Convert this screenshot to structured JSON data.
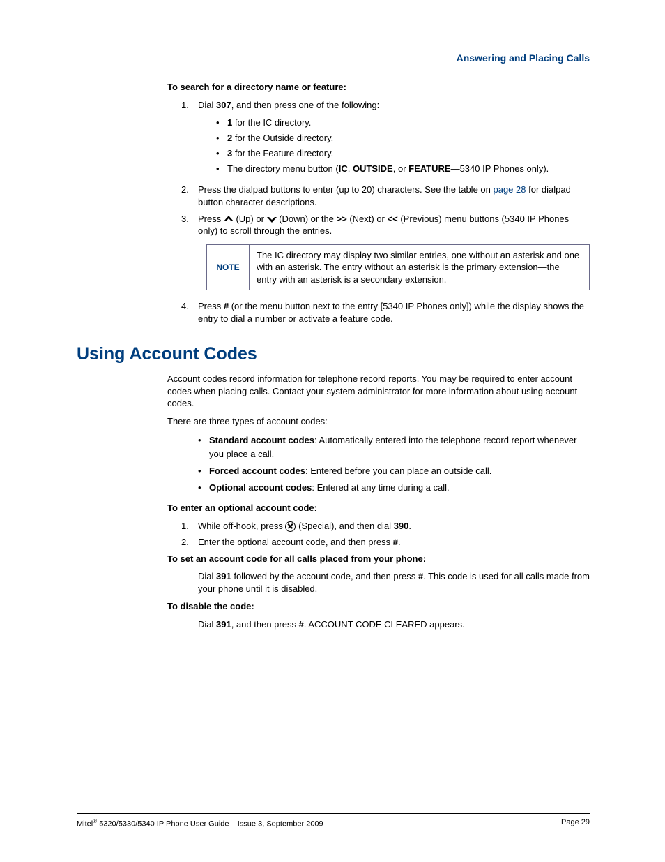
{
  "header": {
    "title": "Answering and Placing Calls"
  },
  "search": {
    "heading": "To search for a directory name or feature:",
    "step1_a": "Dial ",
    "step1_code": "307",
    "step1_b": ", and then press one of the following:",
    "bullets": {
      "b1_a": "1",
      "b1_b": " for the IC directory.",
      "b2_a": "2",
      "b2_b": " for the Outside directory.",
      "b3_a": "3",
      "b3_b": " for the Feature directory.",
      "b4_a": "The directory menu button (",
      "b4_ic": "IC",
      "b4_b": ", ",
      "b4_out": "OUTSIDE",
      "b4_c": ", or ",
      "b4_feat": "FEATURE",
      "b4_d": "—5340 IP Phones only)."
    },
    "step2_a": "Press the dialpad buttons to enter (up to 20) characters. See the table on ",
    "step2_link": "page 28",
    "step2_b": " for dialpad button character descriptions.",
    "step3_a": "Press ",
    "step3_up": " (Up) or ",
    "step3_down": " (Down) or the ",
    "step3_next": ">>",
    "step3_next_t": " (Next) or ",
    "step3_prev": "<<",
    "step3_prev_t": " (Previous) menu buttons (5340 IP Phones only) to scroll through the entries.",
    "note_label": "NOTE",
    "note_text": "The IC directory may display two similar entries, one without an asterisk and one with an asterisk. The entry without an asterisk is the primary extension—the entry with an asterisk is a secondary extension.",
    "step4_a": "Press ",
    "step4_hash": "#",
    "step4_b": " (or the menu button next to the entry [5340 IP Phones only]) while the display shows the entry to dial a number or activate a feature code."
  },
  "nums": {
    "n1": "1.",
    "n2": "2.",
    "n3": "3.",
    "n4": "4."
  },
  "account": {
    "title": "Using Account Codes",
    "intro": "Account codes record information for telephone record reports. You may be required to enter account codes when placing calls. Contact your system administrator for more information about using account codes.",
    "types_intro": "There are three types of account codes:",
    "std_label": "Standard account codes",
    "std_text": ": Automatically entered into the telephone record report whenever you place a call.",
    "forced_label": "Forced account codes",
    "forced_text": ": Entered before you can place an outside call.",
    "opt_label": "Optional account codes",
    "opt_text": ": Entered at any time during a call.",
    "enter_heading": "To enter an optional account code:",
    "enter_s1_a": "While off-hook, press ",
    "enter_s1_b": " (Special), and then dial ",
    "enter_s1_code": "390",
    "enter_s1_c": ".",
    "enter_s2_a": "Enter the optional account code, and then press ",
    "enter_s2_hash": "#",
    "enter_s2_b": ".",
    "set_heading": "To set an account code for all calls placed from your phone:",
    "set_a": "Dial ",
    "set_code": "391",
    "set_b": " followed by the account code, and then press ",
    "set_hash": "#",
    "set_c": ". This code is used for all calls made from your phone until it is disabled.",
    "disable_heading": "To disable the code:",
    "dis_a": "Dial ",
    "dis_code": "391",
    "dis_b": ", and then press ",
    "dis_hash": "#",
    "dis_c": ". ACCOUNT CODE CLEARED appears."
  },
  "footer": {
    "left_a": "Mitel",
    "left_b": " 5320/5330/5340 IP Phone User Guide  – Issue 3, September 2009",
    "right": "Page 29"
  }
}
